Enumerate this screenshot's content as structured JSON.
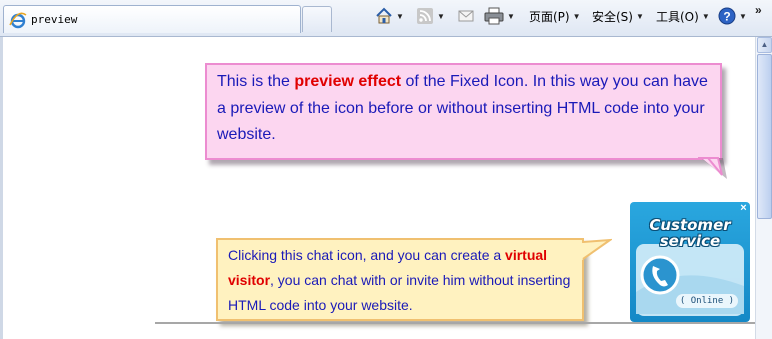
{
  "tab": {
    "title": "preview"
  },
  "toolbar": {
    "home_icon": "home-icon",
    "feeds_icon": "feeds-icon",
    "mail_icon": "mail-icon",
    "print_icon": "print-icon",
    "page_label": "页面(P)",
    "safety_label": "安全(S)",
    "tools_label": "工具(O)",
    "help_icon": "help-icon",
    "overflow_label": "»"
  },
  "preview_note": {
    "before": "This is the ",
    "highlight": "preview effect",
    "after": " of the Fixed Icon. In this way you can have a preview of the icon before or without inserting HTML code into your website."
  },
  "chat_note": {
    "before": "Clicking this chat icon, and you can create a ",
    "highlight": "virtual visitor",
    "after": ", you can chat with or invite him without inserting HTML code into your website."
  },
  "widget": {
    "line1": "Customer",
    "line2": "service",
    "status": "( Online )",
    "close": "×"
  },
  "colors": {
    "text_blue": "#1a1ab8",
    "highlight_red": "#e00000",
    "pink_bg": "#fcd6f0",
    "pink_border": "#ec8cd0",
    "yellow_bg": "#fff2c0",
    "yellow_border": "#f0c070",
    "widget_blue": "#1f9bd4"
  }
}
